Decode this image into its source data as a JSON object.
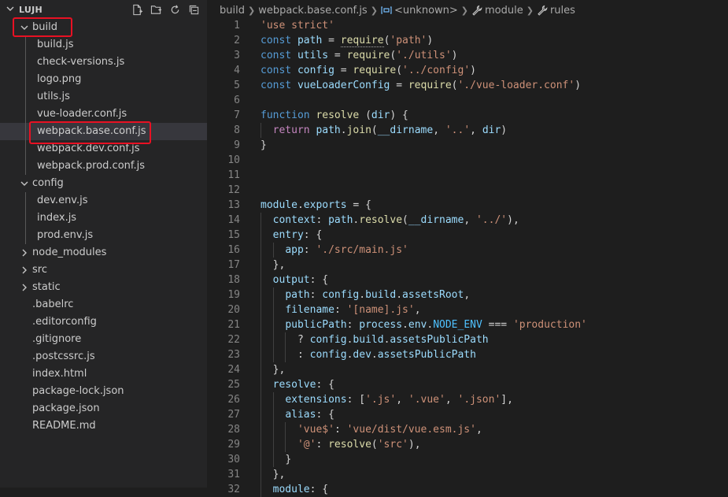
{
  "explorer": {
    "root": "LUJH",
    "collapse_chevron": "chevron-down-icon",
    "actions": [
      {
        "name": "new-file-button",
        "icon": "new-file-icon"
      },
      {
        "name": "new-folder-button",
        "icon": "new-folder-icon"
      },
      {
        "name": "refresh-button",
        "icon": "refresh-icon"
      },
      {
        "name": "collapse-all-button",
        "icon": "collapse-all-icon"
      }
    ],
    "items": [
      {
        "label": "build",
        "type": "folder",
        "depth": 0,
        "expanded": true
      },
      {
        "label": "build.js",
        "type": "file",
        "depth": 1
      },
      {
        "label": "check-versions.js",
        "type": "file",
        "depth": 1
      },
      {
        "label": "logo.png",
        "type": "file",
        "depth": 1
      },
      {
        "label": "utils.js",
        "type": "file",
        "depth": 1
      },
      {
        "label": "vue-loader.conf.js",
        "type": "file",
        "depth": 1
      },
      {
        "label": "webpack.base.conf.js",
        "type": "file",
        "depth": 1,
        "selected": true
      },
      {
        "label": "webpack.dev.conf.js",
        "type": "file",
        "depth": 1
      },
      {
        "label": "webpack.prod.conf.js",
        "type": "file",
        "depth": 1
      },
      {
        "label": "config",
        "type": "folder",
        "depth": 0,
        "expanded": true
      },
      {
        "label": "dev.env.js",
        "type": "file",
        "depth": 1
      },
      {
        "label": "index.js",
        "type": "file",
        "depth": 1
      },
      {
        "label": "prod.env.js",
        "type": "file",
        "depth": 1
      },
      {
        "label": "node_modules",
        "type": "folder",
        "depth": 0,
        "expanded": false
      },
      {
        "label": "src",
        "type": "folder",
        "depth": 0,
        "expanded": false
      },
      {
        "label": "static",
        "type": "folder",
        "depth": 0,
        "expanded": false
      },
      {
        "label": ".babelrc",
        "type": "file",
        "depth": 0
      },
      {
        "label": ".editorconfig",
        "type": "file",
        "depth": 0
      },
      {
        "label": ".gitignore",
        "type": "file",
        "depth": 0
      },
      {
        "label": ".postcssrc.js",
        "type": "file",
        "depth": 0
      },
      {
        "label": "index.html",
        "type": "file",
        "depth": 0
      },
      {
        "label": "package-lock.json",
        "type": "file",
        "depth": 0
      },
      {
        "label": "package.json",
        "type": "file",
        "depth": 0
      },
      {
        "label": "README.md",
        "type": "file",
        "depth": 0
      }
    ],
    "highlight_color": "#e81123"
  },
  "breadcrumb": {
    "folder": "build",
    "file": "webpack.base.conf.js",
    "symbol1": "<unknown>",
    "symbol1_icon": "variable-icon",
    "symbol2": "module",
    "symbol2_icon": "wrench-icon",
    "symbol3": "rules",
    "symbol3_icon": "wrench-icon"
  },
  "editor": {
    "lines": [
      {
        "n": "1",
        "indent": 0,
        "tokens": [
          [
            "s",
            "'use strict'"
          ]
        ]
      },
      {
        "n": "2",
        "indent": 0,
        "tokens": [
          [
            "k",
            "const"
          ],
          [
            "p",
            " "
          ],
          [
            "v",
            "path"
          ],
          [
            "p",
            " = "
          ],
          [
            "f",
            "require",
            "und"
          ],
          [
            "p",
            "("
          ],
          [
            "s",
            "'path'"
          ],
          [
            "p",
            ")"
          ]
        ]
      },
      {
        "n": "3",
        "indent": 0,
        "tokens": [
          [
            "k",
            "const"
          ],
          [
            "p",
            " "
          ],
          [
            "v",
            "utils"
          ],
          [
            "p",
            " = "
          ],
          [
            "f",
            "require"
          ],
          [
            "p",
            "("
          ],
          [
            "s",
            "'./utils'"
          ],
          [
            "p",
            ")"
          ]
        ]
      },
      {
        "n": "4",
        "indent": 0,
        "tokens": [
          [
            "k",
            "const"
          ],
          [
            "p",
            " "
          ],
          [
            "v",
            "config"
          ],
          [
            "p",
            " = "
          ],
          [
            "f",
            "require"
          ],
          [
            "p",
            "("
          ],
          [
            "s",
            "'../config'"
          ],
          [
            "p",
            ")"
          ]
        ]
      },
      {
        "n": "5",
        "indent": 0,
        "tokens": [
          [
            "k",
            "const"
          ],
          [
            "p",
            " "
          ],
          [
            "v",
            "vueLoaderConfig"
          ],
          [
            "p",
            " = "
          ],
          [
            "f",
            "require"
          ],
          [
            "p",
            "("
          ],
          [
            "s",
            "'./vue-loader.conf'"
          ],
          [
            "p",
            ")"
          ]
        ]
      },
      {
        "n": "6",
        "indent": 0,
        "tokens": []
      },
      {
        "n": "7",
        "indent": 0,
        "tokens": [
          [
            "k",
            "function"
          ],
          [
            "p",
            " "
          ],
          [
            "f",
            "resolve"
          ],
          [
            "p",
            " ("
          ],
          [
            "v",
            "dir"
          ],
          [
            "p",
            ") {"
          ]
        ]
      },
      {
        "n": "8",
        "indent": 1,
        "tokens": [
          [
            "kw",
            "return"
          ],
          [
            "p",
            " "
          ],
          [
            "v",
            "path"
          ],
          [
            "p",
            "."
          ],
          [
            "f",
            "join"
          ],
          [
            "p",
            "("
          ],
          [
            "v",
            "__dirname"
          ],
          [
            "p",
            ", "
          ],
          [
            "s",
            "'..'"
          ],
          [
            "p",
            ", "
          ],
          [
            "v",
            "dir"
          ],
          [
            "p",
            ")"
          ]
        ]
      },
      {
        "n": "9",
        "indent": 0,
        "tokens": [
          [
            "p",
            "}"
          ]
        ]
      },
      {
        "n": "10",
        "indent": 0,
        "tokens": []
      },
      {
        "n": "11",
        "indent": 0,
        "tokens": []
      },
      {
        "n": "12",
        "indent": 0,
        "tokens": []
      },
      {
        "n": "13",
        "indent": 0,
        "tokens": [
          [
            "v",
            "module"
          ],
          [
            "p",
            "."
          ],
          [
            "v",
            "exports"
          ],
          [
            "p",
            " = {"
          ]
        ]
      },
      {
        "n": "14",
        "indent": 1,
        "tokens": [
          [
            "v",
            "context"
          ],
          [
            "p",
            ": "
          ],
          [
            "v",
            "path"
          ],
          [
            "p",
            "."
          ],
          [
            "f",
            "resolve"
          ],
          [
            "p",
            "("
          ],
          [
            "v",
            "__dirname"
          ],
          [
            "p",
            ", "
          ],
          [
            "s",
            "'../'"
          ],
          [
            "p",
            "),"
          ]
        ]
      },
      {
        "n": "15",
        "indent": 1,
        "tokens": [
          [
            "v",
            "entry"
          ],
          [
            "p",
            ": {"
          ]
        ]
      },
      {
        "n": "16",
        "indent": 2,
        "tokens": [
          [
            "v",
            "app"
          ],
          [
            "p",
            ": "
          ],
          [
            "s",
            "'./src/main.js'"
          ]
        ]
      },
      {
        "n": "17",
        "indent": 1,
        "tokens": [
          [
            "p",
            "},"
          ]
        ]
      },
      {
        "n": "18",
        "indent": 1,
        "tokens": [
          [
            "v",
            "output"
          ],
          [
            "p",
            ": {"
          ]
        ]
      },
      {
        "n": "19",
        "indent": 2,
        "tokens": [
          [
            "v",
            "path"
          ],
          [
            "p",
            ": "
          ],
          [
            "v",
            "config"
          ],
          [
            "p",
            "."
          ],
          [
            "v",
            "build"
          ],
          [
            "p",
            "."
          ],
          [
            "v",
            "assetsRoot"
          ],
          [
            "p",
            ","
          ]
        ]
      },
      {
        "n": "20",
        "indent": 2,
        "tokens": [
          [
            "v",
            "filename"
          ],
          [
            "p",
            ": "
          ],
          [
            "s",
            "'[name].js'"
          ],
          [
            "p",
            ","
          ]
        ]
      },
      {
        "n": "21",
        "indent": 2,
        "tokens": [
          [
            "v",
            "publicPath"
          ],
          [
            "p",
            ": "
          ],
          [
            "v",
            "process"
          ],
          [
            "p",
            "."
          ],
          [
            "v",
            "env"
          ],
          [
            "p",
            "."
          ],
          [
            "c",
            "NODE_ENV"
          ],
          [
            "p",
            " === "
          ],
          [
            "s",
            "'production'"
          ]
        ]
      },
      {
        "n": "22",
        "indent": 3,
        "tokens": [
          [
            "p",
            "? "
          ],
          [
            "v",
            "config"
          ],
          [
            "p",
            "."
          ],
          [
            "v",
            "build"
          ],
          [
            "p",
            "."
          ],
          [
            "v",
            "assetsPublicPath"
          ]
        ]
      },
      {
        "n": "23",
        "indent": 3,
        "tokens": [
          [
            "p",
            ": "
          ],
          [
            "v",
            "config"
          ],
          [
            "p",
            "."
          ],
          [
            "v",
            "dev"
          ],
          [
            "p",
            "."
          ],
          [
            "v",
            "assetsPublicPath"
          ]
        ]
      },
      {
        "n": "24",
        "indent": 1,
        "tokens": [
          [
            "p",
            "},"
          ]
        ]
      },
      {
        "n": "25",
        "indent": 1,
        "tokens": [
          [
            "v",
            "resolve"
          ],
          [
            "p",
            ": {"
          ]
        ]
      },
      {
        "n": "26",
        "indent": 2,
        "tokens": [
          [
            "v",
            "extensions"
          ],
          [
            "p",
            ": ["
          ],
          [
            "s",
            "'.js'"
          ],
          [
            "p",
            ", "
          ],
          [
            "s",
            "'.vue'"
          ],
          [
            "p",
            ", "
          ],
          [
            "s",
            "'.json'"
          ],
          [
            "p",
            "],"
          ]
        ]
      },
      {
        "n": "27",
        "indent": 2,
        "tokens": [
          [
            "v",
            "alias"
          ],
          [
            "p",
            ": {"
          ]
        ]
      },
      {
        "n": "28",
        "indent": 3,
        "tokens": [
          [
            "s",
            "'vue$'"
          ],
          [
            "p",
            ": "
          ],
          [
            "s",
            "'vue/dist/vue.esm.js'"
          ],
          [
            "p",
            ","
          ]
        ]
      },
      {
        "n": "29",
        "indent": 3,
        "tokens": [
          [
            "s",
            "'@'"
          ],
          [
            "p",
            ": "
          ],
          [
            "f",
            "resolve"
          ],
          [
            "p",
            "("
          ],
          [
            "s",
            "'src'"
          ],
          [
            "p",
            "),"
          ]
        ]
      },
      {
        "n": "30",
        "indent": 2,
        "tokens": [
          [
            "p",
            "}"
          ]
        ]
      },
      {
        "n": "31",
        "indent": 1,
        "tokens": [
          [
            "p",
            "},"
          ]
        ]
      },
      {
        "n": "32",
        "indent": 1,
        "tokens": [
          [
            "v",
            "module"
          ],
          [
            "p",
            ": {"
          ]
        ]
      }
    ]
  }
}
